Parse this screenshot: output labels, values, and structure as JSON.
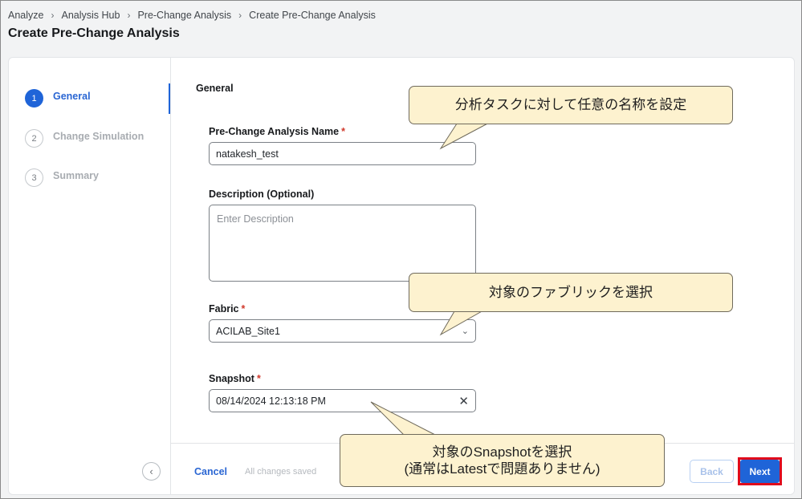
{
  "breadcrumb": [
    "Analyze",
    "Analysis Hub",
    "Pre-Change Analysis",
    "Create Pre-Change Analysis"
  ],
  "page_title": "Create Pre-Change Analysis",
  "steps": [
    {
      "number": "1",
      "label": "General",
      "active": true
    },
    {
      "number": "2",
      "label": "Change Simulation",
      "active": false
    },
    {
      "number": "3",
      "label": "Summary",
      "active": false
    }
  ],
  "form": {
    "section_title": "General",
    "name_label": "Pre-Change Analysis Name",
    "name_value": "natakesh_test",
    "description_label": "Description (Optional)",
    "description_placeholder": "Enter Description",
    "fabric_label": "Fabric",
    "fabric_value": "ACILAB_Site1",
    "snapshot_label": "Snapshot",
    "snapshot_value": "08/14/2024 12:13:18 PM",
    "required_mark": "*"
  },
  "footer": {
    "cancel_label": "Cancel",
    "saved_status": "All changes saved",
    "back_label": "Back",
    "next_label": "Next"
  },
  "callouts": {
    "name": "分析タスクに対して任意の名称を設定",
    "fabric": "対象のファブリックを選択",
    "snapshot_line1": "対象のSnapshotを選択",
    "snapshot_line2": "(通常はLatestで問題ありません)"
  },
  "icons": {
    "breadcrumb_separator": "chevron-right-icon",
    "collapse": "chevron-left-icon",
    "fabric_dropdown": "chevron-down-icon",
    "snapshot_clear": "close-icon"
  },
  "colors": {
    "accent": "#1f64d8",
    "required": "#d0392b",
    "highlight": "#e00b1c",
    "callout_fill": "#fdf2cf"
  }
}
